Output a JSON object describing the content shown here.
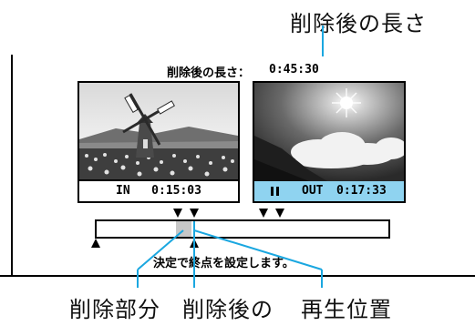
{
  "annotations": {
    "top_label": "削除後の長さ",
    "bottom_labels": [
      "削除部分",
      "削除後の",
      "再生位置"
    ]
  },
  "screen": {
    "length_label": "削除後の長さ：",
    "length_value": "0:45:30",
    "left_thumb": {
      "mark": "IN",
      "time": "0:15:03"
    },
    "right_thumb": {
      "mark": "OUT",
      "time": "0:17:33"
    },
    "message": "決定で終点を設定します。"
  },
  "colors": {
    "callout_line": "#1aa7e0",
    "caption_highlight": "#8fd3f0",
    "deleted_segment": "#c7c7c7"
  },
  "icons": {
    "marker_down": "down-triangle",
    "marker_up": "up-triangle",
    "pause": "pause-icon"
  }
}
